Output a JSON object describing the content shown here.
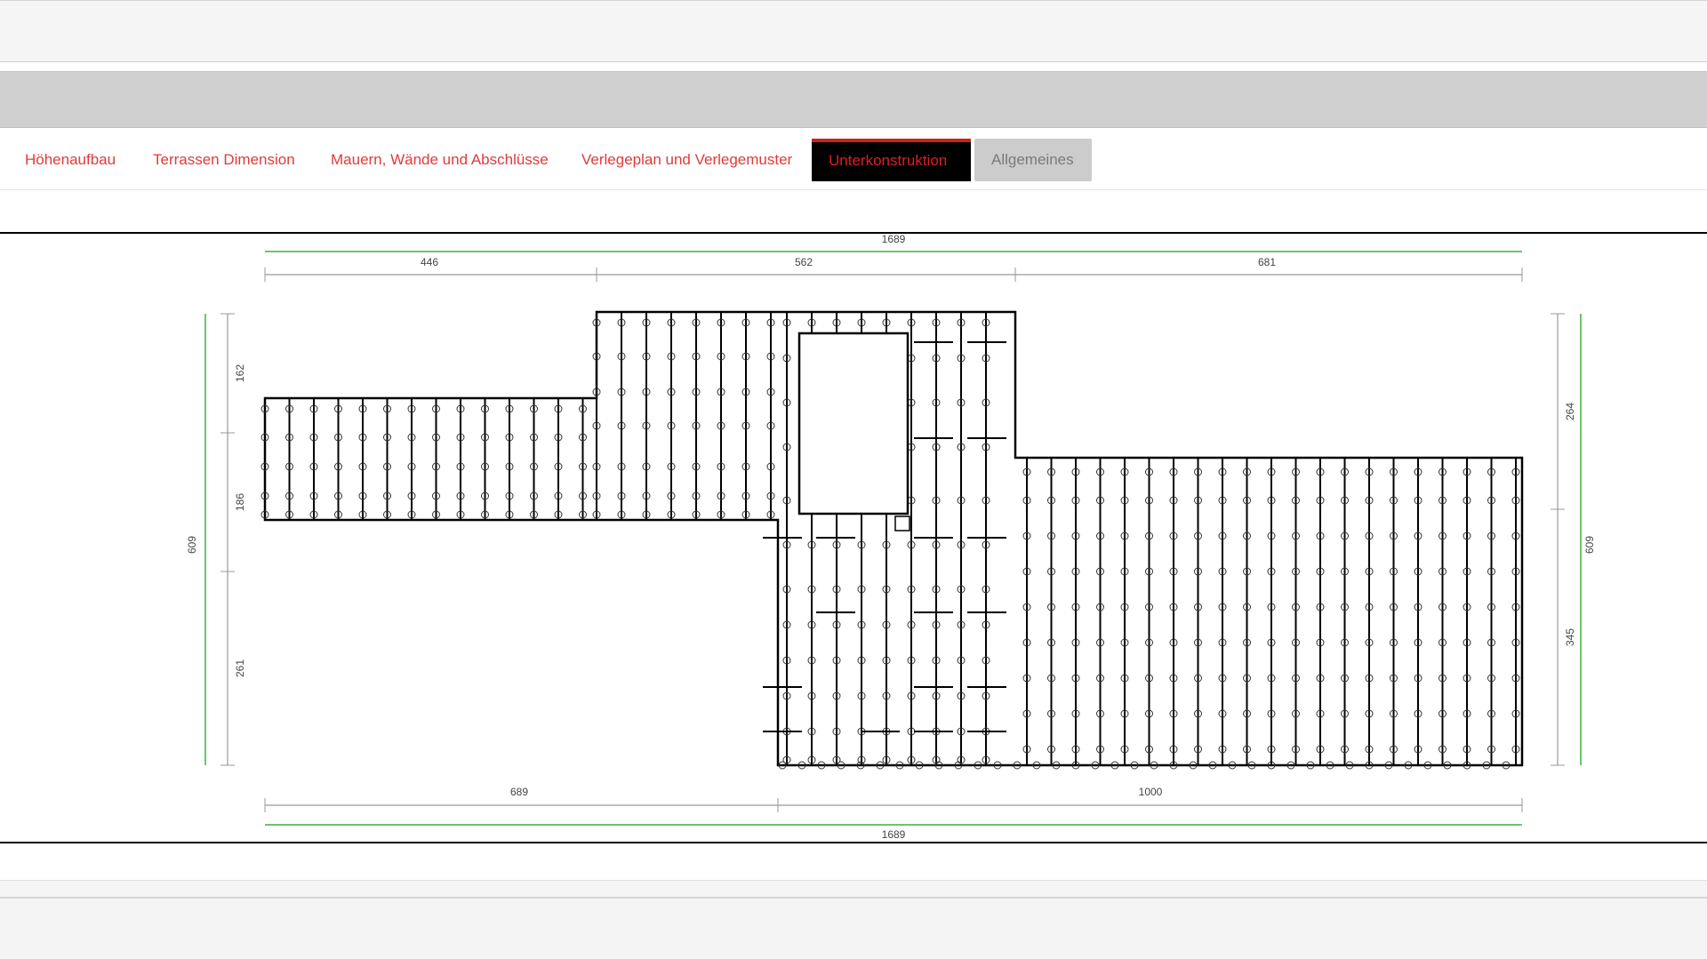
{
  "tabs": [
    {
      "label": "Höhenaufbau",
      "state": "normal"
    },
    {
      "label": "Terrassen Dimension",
      "state": "normal"
    },
    {
      "label": "Mauern, Wände und Abschlüsse",
      "state": "normal"
    },
    {
      "label": "Verlegeplan und Verlegemuster",
      "state": "normal"
    },
    {
      "label": "Unterkonstruktion",
      "state": "active"
    },
    {
      "label": "Allgemeines",
      "state": "disabled"
    }
  ],
  "plan": {
    "total_width_top": "1689",
    "top_segments": [
      "446",
      "562",
      "681"
    ],
    "total_width_bottom": "1689",
    "bottom_segments": [
      "689",
      "1000"
    ],
    "left_total": "609",
    "left_segments": [
      "162",
      "186",
      "261"
    ],
    "right_total": "609",
    "right_segments": [
      "264",
      "345"
    ]
  },
  "colors": {
    "tab_text": "#e23a3a",
    "tab_active_bg": "#000000",
    "tab_active_text": "#e11f1f",
    "tab_disabled_bg": "#cccccc",
    "total_dimension_line": "#6cc56c",
    "dimension_line": "#999999",
    "structure": "#000000"
  }
}
